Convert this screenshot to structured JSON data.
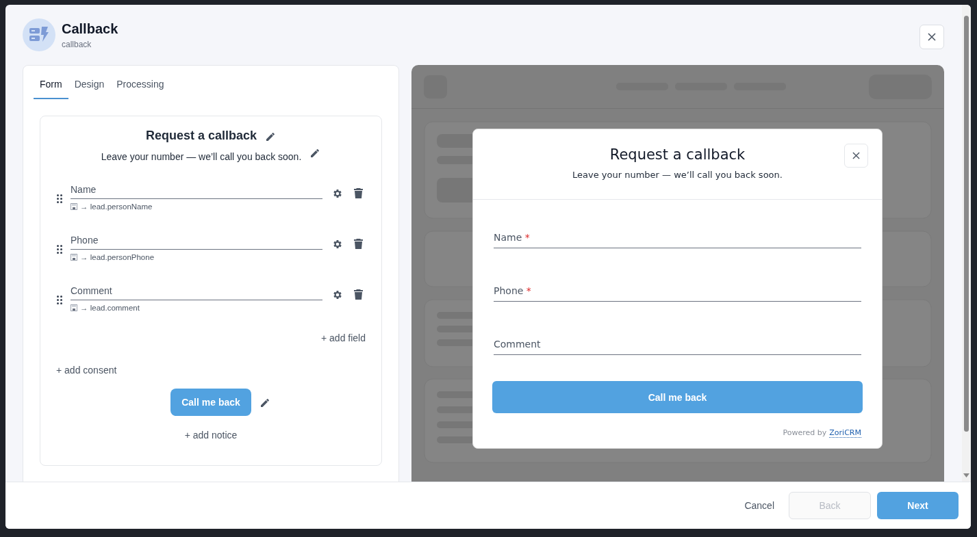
{
  "dialog": {
    "title": "Callback",
    "subtitle": "callback"
  },
  "tabs": [
    {
      "label": "Form",
      "selected": true
    },
    {
      "label": "Design",
      "selected": false
    },
    {
      "label": "Processing",
      "selected": false
    }
  ],
  "editor": {
    "title": "Request a callback",
    "description": "Leave your number — we’ll call you back soon.",
    "fields": [
      {
        "label": "Name",
        "binding": "→ lead.personName"
      },
      {
        "label": "Phone",
        "binding": "→ lead.personPhone"
      },
      {
        "label": "Comment",
        "binding": "→ lead.comment"
      }
    ],
    "add_field": "+ add field",
    "add_consent": "+ add consent",
    "submit_label": "Call me back",
    "add_notice": "+ add notice"
  },
  "preview": {
    "title": "Request a callback",
    "description": "Leave your number — we’ll call you back soon.",
    "fields": [
      {
        "label": "Name",
        "required_mark": "*"
      },
      {
        "label": "Phone",
        "required_mark": "*"
      },
      {
        "label": "Comment"
      }
    ],
    "submit_label": "Call me back",
    "powered_by": "Powered by",
    "brand_link": "ZoriCRM"
  },
  "footer": {
    "buttons": [
      {
        "label": "Cancel",
        "kind": "text"
      },
      {
        "label": "Back",
        "kind": "outline",
        "disabled": true
      },
      {
        "label": "Next",
        "kind": "primary"
      }
    ]
  }
}
